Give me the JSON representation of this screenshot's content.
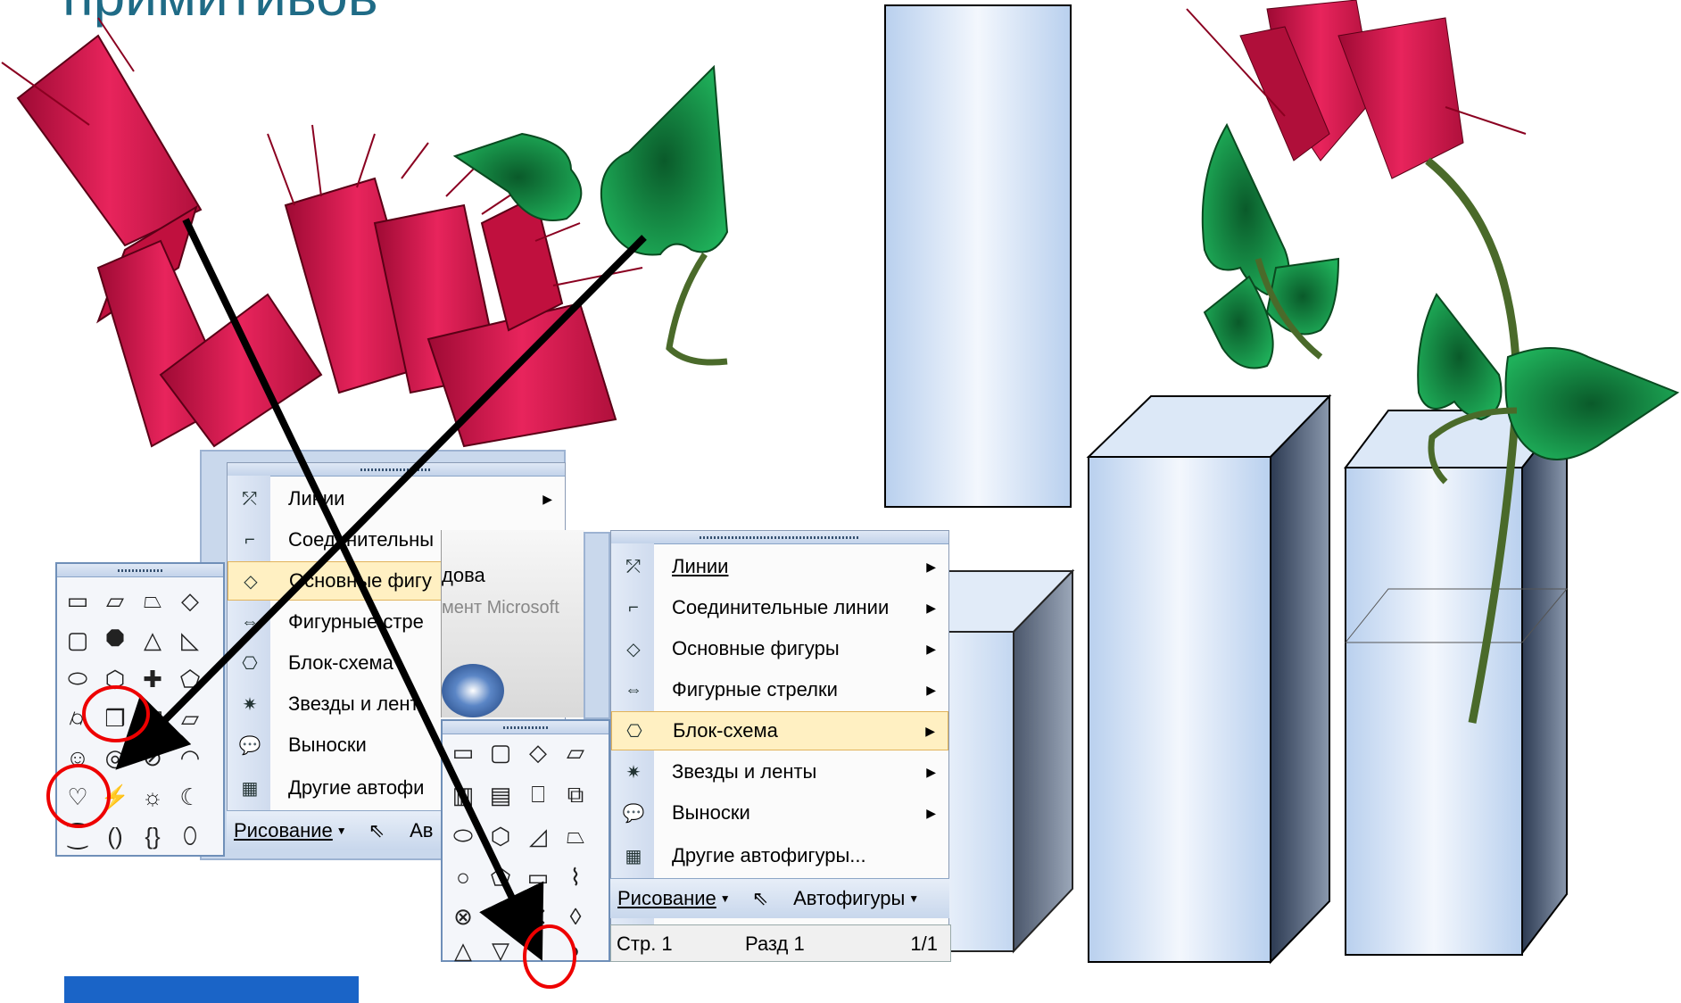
{
  "title": "примитивов",
  "left_menu": {
    "items": [
      {
        "label": "Линии",
        "icon": "lines-icon",
        "submenu": true
      },
      {
        "label": "Соединительны",
        "icon": "connector-icon",
        "submenu": false
      },
      {
        "label": "Основные фигу",
        "icon": "basic-shapes-icon",
        "submenu": false,
        "highlighted": true
      },
      {
        "label": "Фигурные стре",
        "icon": "block-arrows-icon",
        "submenu": false
      },
      {
        "label": "Блок-схема",
        "icon": "flowchart-icon",
        "submenu": false
      },
      {
        "label": "Звезды и лент",
        "icon": "stars-icon",
        "submenu": false
      },
      {
        "label": "Выноски",
        "icon": "callouts-icon",
        "submenu": false
      },
      {
        "label": "Другие автофи",
        "icon": "more-autoshapes-icon",
        "submenu": false
      }
    ],
    "toolbar": {
      "drawing": "Рисование",
      "autoshapes": "Ав"
    }
  },
  "middle_background": {
    "text1": "дова",
    "text2": "мент Microsoft"
  },
  "right_menu": {
    "items": [
      {
        "label": "Линии",
        "icon": "lines-icon"
      },
      {
        "label": "Соединительные линии",
        "icon": "connector-icon"
      },
      {
        "label": "Основные фигуры",
        "icon": "basic-shapes-icon"
      },
      {
        "label": "Фигурные стрелки",
        "icon": "block-arrows-icon"
      },
      {
        "label": "Блок-схема",
        "icon": "flowchart-icon",
        "highlighted": true
      },
      {
        "label": "Звезды и ленты",
        "icon": "stars-icon"
      },
      {
        "label": "Выноски",
        "icon": "callouts-icon"
      },
      {
        "label": "Другие автофигуры...",
        "icon": "more-autoshapes-icon"
      }
    ],
    "toolbar": {
      "drawing": "Рисование",
      "autoshapes": "Автофигуры"
    },
    "status": {
      "page": "Стр. 1",
      "section": "Разд 1",
      "pages": "1/1"
    }
  },
  "colors": {
    "title": "#1f6b86",
    "cylinder": "#d4124a",
    "leaf": "#1a9a4a",
    "box": "#c8dbf2",
    "highlight_menu": "#fff0c2"
  }
}
